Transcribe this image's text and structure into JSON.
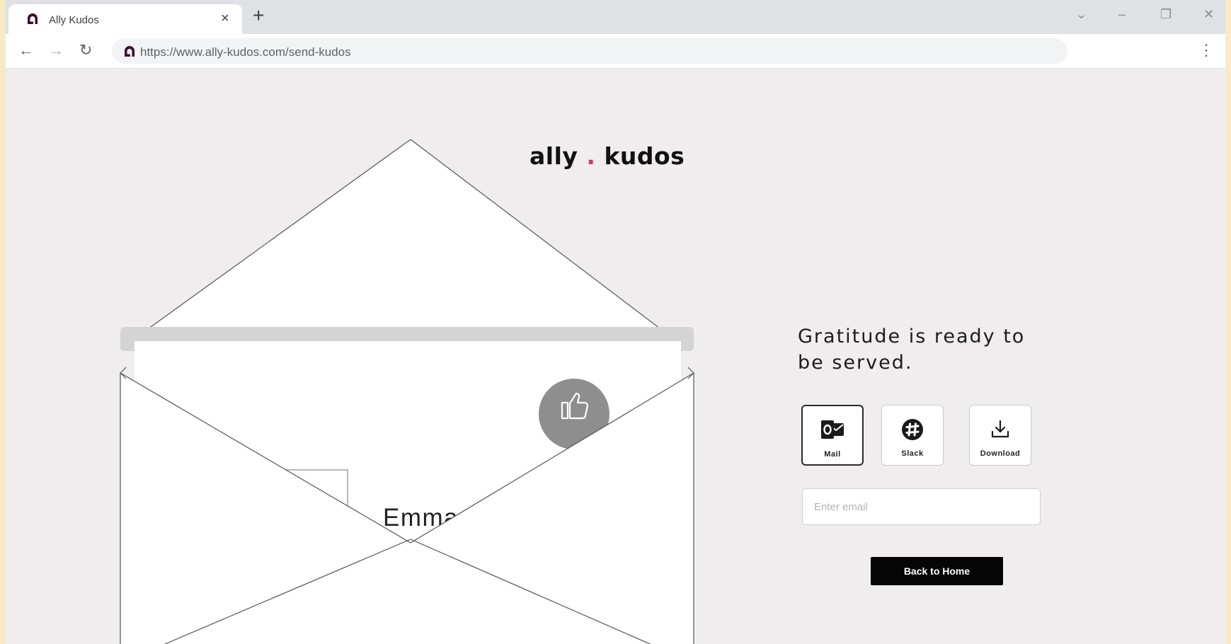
{
  "browser": {
    "tab": {
      "title": "Ally Kudos",
      "close_glyph": "×",
      "favicon": "ally-logo-icon"
    },
    "new_tab_glyph": "+",
    "window_controls": {
      "dropdown": "⌄",
      "minimize": "–",
      "restore": "❐",
      "close": "✕"
    },
    "toolbar": {
      "back": "←",
      "forward": "→",
      "reload": "↻",
      "menu": "⋮"
    },
    "address_bar": {
      "url": "https://www.ally-kudos.com/send-kudos"
    }
  },
  "logo": {
    "part1": "ally",
    "dot": ".",
    "part2": "kudos",
    "dot_color": "#d2385a"
  },
  "card": {
    "recipient_fragment": "Emma",
    "icon": "thumbs-up-icon"
  },
  "share": {
    "headline": "Gratitude is ready to be served.",
    "options": [
      {
        "label": "Mail",
        "icon": "outlook-mail-icon",
        "selected": true
      },
      {
        "label": "Slack",
        "icon": "slack-icon",
        "selected": false
      },
      {
        "label": "Download",
        "icon": "download-icon",
        "selected": false
      }
    ],
    "email_placeholder": "Enter email",
    "back_button_label": "Back to Home"
  }
}
